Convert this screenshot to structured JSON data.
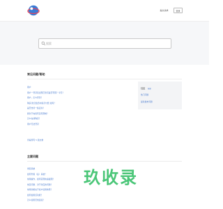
{
  "header": {
    "login_label": "提交请求",
    "signup_label": "登录"
  },
  "search": {
    "placeholder": "搜索"
  },
  "faq_section": {
    "title": "常见问题/帮助",
    "items": [
      "用户",
      "用户一登录就出现已激活是否有限？今天？",
      "用户，怎么登录？",
      "购买/激活会员时提示付费 如何？",
      "是否支持一些证书？",
      "我对于充值有没有限制？",
      "怎么在线购买？",
      "用户无法登录"
    ],
    "more_label": "查看所有 5 篇文章"
  },
  "sidebar": {
    "title": "社区",
    "badge": "新建",
    "items": [
      "热门问题",
      "最新发布问题"
    ]
  },
  "other_section": {
    "title": "主要问题",
    "items": [
      "重装系统",
      "如何升级（后）系统？",
      "常用操作，如何实现快速截图？",
      "常见问题：对于对应的问题？",
      "常用功能在于客户使用效果？",
      "如何使用该功能？",
      "怎么使用无线连接？"
    ]
  },
  "watermark": {
    "text": "玖收录"
  },
  "colors": {
    "link": "#4f7fd0",
    "search_band": "#f6f7f9",
    "watermark": "#38c06a"
  }
}
